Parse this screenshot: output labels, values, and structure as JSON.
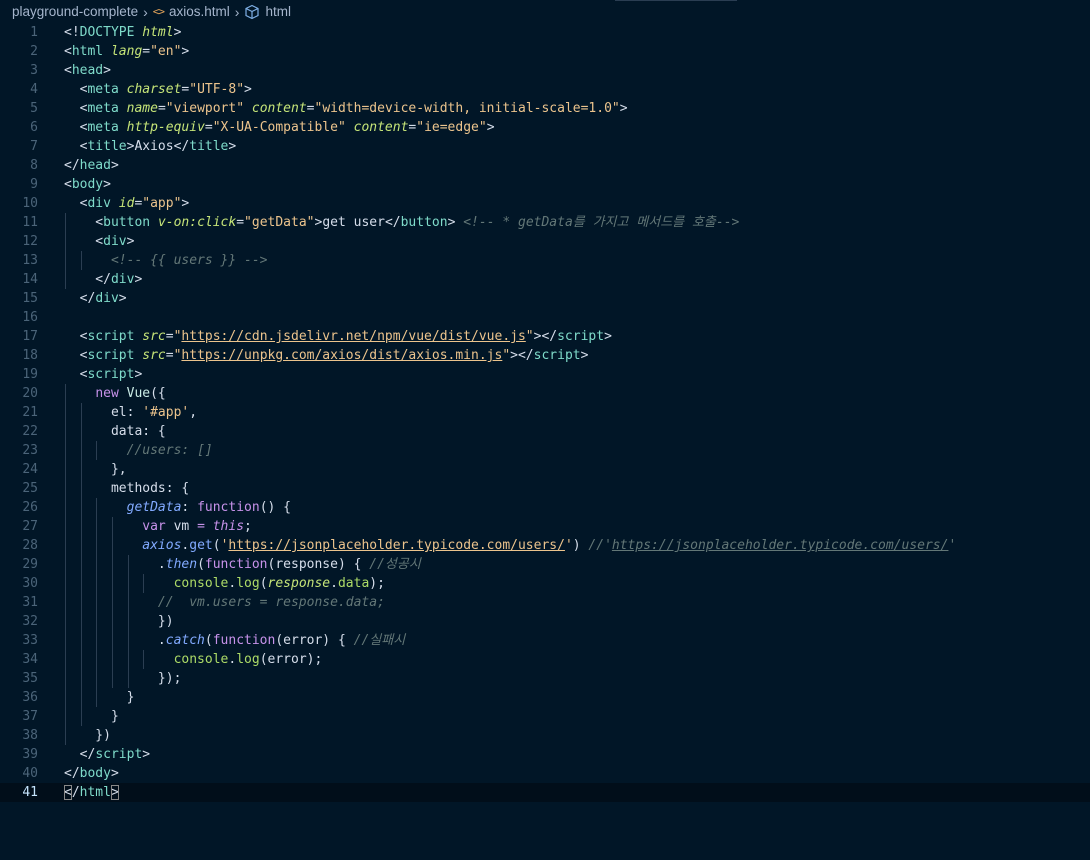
{
  "breadcrumb": {
    "folder": "playground-complete",
    "file": "axios.html",
    "file_icon": "<>",
    "symbol": "html"
  },
  "colors": {
    "background": "#011627",
    "tag": "#7fdbca",
    "attribute": "#c5e478",
    "string": "#ecc48d",
    "comment": "#637777",
    "keyword": "#c792ea",
    "function": "#82aaff"
  },
  "editor": {
    "language": "html",
    "current_line": 41,
    "lines": [
      {
        "n": "1",
        "indent": 0,
        "tokens": [
          [
            "p",
            "<!"
          ],
          [
            "t",
            "DOCTYPE"
          ],
          [
            "p",
            " "
          ],
          [
            "a",
            "html"
          ],
          [
            "p",
            ">"
          ]
        ]
      },
      {
        "n": "2",
        "indent": 0,
        "tokens": [
          [
            "p",
            "<"
          ],
          [
            "t",
            "html"
          ],
          [
            "p",
            " "
          ],
          [
            "a",
            "lang"
          ],
          [
            "p",
            "="
          ],
          [
            "s",
            "\"en\""
          ],
          [
            "p",
            ">"
          ]
        ]
      },
      {
        "n": "3",
        "indent": 0,
        "tokens": [
          [
            "p",
            "<"
          ],
          [
            "t",
            "head"
          ],
          [
            "p",
            ">"
          ]
        ]
      },
      {
        "n": "4",
        "indent": 1,
        "tokens": [
          [
            "p",
            "  <"
          ],
          [
            "t",
            "meta"
          ],
          [
            "p",
            " "
          ],
          [
            "a",
            "charset"
          ],
          [
            "p",
            "="
          ],
          [
            "s",
            "\"UTF-8\""
          ],
          [
            "p",
            ">"
          ]
        ]
      },
      {
        "n": "5",
        "indent": 1,
        "tokens": [
          [
            "p",
            "  <"
          ],
          [
            "t",
            "meta"
          ],
          [
            "p",
            " "
          ],
          [
            "a",
            "name"
          ],
          [
            "p",
            "="
          ],
          [
            "s",
            "\"viewport\""
          ],
          [
            "p",
            " "
          ],
          [
            "a",
            "content"
          ],
          [
            "p",
            "="
          ],
          [
            "s",
            "\"width=device-width, initial-scale=1.0\""
          ],
          [
            "p",
            ">"
          ]
        ]
      },
      {
        "n": "6",
        "indent": 1,
        "tokens": [
          [
            "p",
            "  <"
          ],
          [
            "t",
            "meta"
          ],
          [
            "p",
            " "
          ],
          [
            "a",
            "http-equiv"
          ],
          [
            "p",
            "="
          ],
          [
            "s",
            "\"X-UA-Compatible\""
          ],
          [
            "p",
            " "
          ],
          [
            "a",
            "content"
          ],
          [
            "p",
            "="
          ],
          [
            "s",
            "\"ie=edge\""
          ],
          [
            "p",
            ">"
          ]
        ]
      },
      {
        "n": "7",
        "indent": 1,
        "tokens": [
          [
            "p",
            "  <"
          ],
          [
            "t",
            "title"
          ],
          [
            "p",
            ">Axios</"
          ],
          [
            "t",
            "title"
          ],
          [
            "p",
            ">"
          ]
        ]
      },
      {
        "n": "8",
        "indent": 0,
        "tokens": [
          [
            "p",
            "</"
          ],
          [
            "t",
            "head"
          ],
          [
            "p",
            ">"
          ]
        ]
      },
      {
        "n": "9",
        "indent": 0,
        "tokens": [
          [
            "p",
            "<"
          ],
          [
            "t",
            "body"
          ],
          [
            "p",
            ">"
          ]
        ]
      },
      {
        "n": "10",
        "indent": 1,
        "tokens": [
          [
            "p",
            "  <"
          ],
          [
            "t",
            "div"
          ],
          [
            "p",
            " "
          ],
          [
            "a",
            "id"
          ],
          [
            "p",
            "="
          ],
          [
            "s",
            "\"app\""
          ],
          [
            "p",
            ">"
          ]
        ]
      },
      {
        "n": "11",
        "indent": 2,
        "tokens": [
          [
            "p",
            "    <"
          ],
          [
            "t",
            "button"
          ],
          [
            "p",
            " "
          ],
          [
            "a",
            "v-on:click"
          ],
          [
            "p",
            "="
          ],
          [
            "s",
            "\"getData\""
          ],
          [
            "p",
            ">get user</"
          ],
          [
            "t",
            "button"
          ],
          [
            "p",
            "> "
          ],
          [
            "c",
            "<!-- * getData를 가지고 메서드를 호출-->"
          ]
        ]
      },
      {
        "n": "12",
        "indent": 2,
        "tokens": [
          [
            "p",
            "    <"
          ],
          [
            "t",
            "div"
          ],
          [
            "p",
            ">"
          ]
        ]
      },
      {
        "n": "13",
        "indent": 3,
        "tokens": [
          [
            "p",
            "      "
          ],
          [
            "c",
            "<!-- {{ users }} -->"
          ]
        ]
      },
      {
        "n": "14",
        "indent": 2,
        "tokens": [
          [
            "p",
            "    </"
          ],
          [
            "t",
            "div"
          ],
          [
            "p",
            ">"
          ]
        ]
      },
      {
        "n": "15",
        "indent": 1,
        "tokens": [
          [
            "p",
            "  </"
          ],
          [
            "t",
            "div"
          ],
          [
            "p",
            ">"
          ]
        ]
      },
      {
        "n": "16",
        "indent": 1,
        "tokens": []
      },
      {
        "n": "17",
        "indent": 1,
        "tokens": [
          [
            "p",
            "  <"
          ],
          [
            "t",
            "script"
          ],
          [
            "p",
            " "
          ],
          [
            "a",
            "src"
          ],
          [
            "p",
            "="
          ],
          [
            "s",
            "\""
          ],
          [
            "su",
            "https://cdn.jsdelivr.net/npm/vue/dist/vue.js"
          ],
          [
            "s",
            "\""
          ],
          [
            "p",
            "></"
          ],
          [
            "t",
            "script"
          ],
          [
            "p",
            ">"
          ]
        ]
      },
      {
        "n": "18",
        "indent": 1,
        "tokens": [
          [
            "p",
            "  <"
          ],
          [
            "t",
            "script"
          ],
          [
            "p",
            " "
          ],
          [
            "a",
            "src"
          ],
          [
            "p",
            "="
          ],
          [
            "s",
            "\""
          ],
          [
            "su",
            "https://unpkg.com/axios/dist/axios.min.js"
          ],
          [
            "s",
            "\""
          ],
          [
            "p",
            "></"
          ],
          [
            "t",
            "script"
          ],
          [
            "p",
            ">"
          ]
        ]
      },
      {
        "n": "19",
        "indent": 1,
        "tokens": [
          [
            "p",
            "  <"
          ],
          [
            "t",
            "script"
          ],
          [
            "p",
            ">"
          ]
        ]
      },
      {
        "n": "20",
        "indent": 2,
        "tokens": [
          [
            "p",
            "    "
          ],
          [
            "k",
            "new"
          ],
          [
            "p",
            " "
          ],
          [
            "tn",
            "Vue"
          ],
          [
            "p",
            "({"
          ]
        ]
      },
      {
        "n": "21",
        "indent": 3,
        "tokens": [
          [
            "p",
            "      el: "
          ],
          [
            "s",
            "'#app'"
          ],
          [
            "p",
            ","
          ]
        ]
      },
      {
        "n": "22",
        "indent": 3,
        "tokens": [
          [
            "p",
            "      data: {"
          ]
        ]
      },
      {
        "n": "23",
        "indent": 4,
        "tokens": [
          [
            "p",
            "        "
          ],
          [
            "c",
            "//users: []"
          ]
        ]
      },
      {
        "n": "24",
        "indent": 3,
        "tokens": [
          [
            "p",
            "      },"
          ]
        ]
      },
      {
        "n": "25",
        "indent": 3,
        "tokens": [
          [
            "p",
            "      methods: {"
          ]
        ]
      },
      {
        "n": "26",
        "indent": 4,
        "tokens": [
          [
            "p",
            "        "
          ],
          [
            "fi",
            "getData"
          ],
          [
            "p",
            ": "
          ],
          [
            "k",
            "function"
          ],
          [
            "p",
            "() {"
          ]
        ]
      },
      {
        "n": "27",
        "indent": 5,
        "tokens": [
          [
            "p",
            "          "
          ],
          [
            "k",
            "var"
          ],
          [
            "p",
            " vm "
          ],
          [
            "k",
            "="
          ],
          [
            "p",
            " "
          ],
          [
            "ki",
            "this"
          ],
          [
            "p",
            ";"
          ]
        ]
      },
      {
        "n": "28",
        "indent": 5,
        "tokens": [
          [
            "p",
            "          "
          ],
          [
            "fi",
            "axios"
          ],
          [
            "p",
            "."
          ],
          [
            "f",
            "get"
          ],
          [
            "p",
            "("
          ],
          [
            "s",
            "'"
          ],
          [
            "su",
            "https://jsonplaceholder.typicode.com/users/"
          ],
          [
            "s",
            "'"
          ],
          [
            "p",
            ") "
          ],
          [
            "c",
            "//'"
          ],
          [
            "cu",
            "https://jsonplaceholder.typicode.com/users/"
          ],
          [
            "c",
            "'"
          ]
        ]
      },
      {
        "n": "29",
        "indent": 6,
        "tokens": [
          [
            "p",
            "            ."
          ],
          [
            "fi",
            "then"
          ],
          [
            "p",
            "("
          ],
          [
            "k",
            "function"
          ],
          [
            "p",
            "(response) { "
          ],
          [
            "c",
            "//성공시"
          ]
        ]
      },
      {
        "n": "30",
        "indent": 7,
        "tokens": [
          [
            "p",
            "              "
          ],
          [
            "cy",
            "console"
          ],
          [
            "p",
            "."
          ],
          [
            "cy",
            "log"
          ],
          [
            "p",
            "("
          ],
          [
            "a",
            "response"
          ],
          [
            "p",
            "."
          ],
          [
            "cy",
            "data"
          ],
          [
            "p",
            ");"
          ]
        ]
      },
      {
        "n": "31",
        "indent": 6,
        "tokens": [
          [
            "p",
            "            "
          ],
          [
            "c",
            "//  vm.users = response.data;"
          ]
        ]
      },
      {
        "n": "32",
        "indent": 6,
        "tokens": [
          [
            "p",
            "            })"
          ]
        ]
      },
      {
        "n": "33",
        "indent": 6,
        "tokens": [
          [
            "p",
            "            ."
          ],
          [
            "fi",
            "catch"
          ],
          [
            "p",
            "("
          ],
          [
            "k",
            "function"
          ],
          [
            "p",
            "(error) { "
          ],
          [
            "c",
            "//실패시"
          ]
        ]
      },
      {
        "n": "34",
        "indent": 7,
        "tokens": [
          [
            "p",
            "              "
          ],
          [
            "cy",
            "console"
          ],
          [
            "p",
            "."
          ],
          [
            "cy",
            "log"
          ],
          [
            "p",
            "(error);"
          ]
        ]
      },
      {
        "n": "35",
        "indent": 6,
        "tokens": [
          [
            "p",
            "            });"
          ]
        ]
      },
      {
        "n": "36",
        "indent": 4,
        "tokens": [
          [
            "p",
            "        }"
          ]
        ]
      },
      {
        "n": "37",
        "indent": 3,
        "tokens": [
          [
            "p",
            "      }"
          ]
        ]
      },
      {
        "n": "38",
        "indent": 2,
        "tokens": [
          [
            "p",
            "    })"
          ]
        ]
      },
      {
        "n": "39",
        "indent": 1,
        "tokens": [
          [
            "p",
            "  </"
          ],
          [
            "t",
            "script"
          ],
          [
            "p",
            ">"
          ]
        ]
      },
      {
        "n": "40",
        "indent": 0,
        "tokens": [
          [
            "p",
            "</"
          ],
          [
            "t",
            "body"
          ],
          [
            "p",
            ">"
          ]
        ]
      },
      {
        "n": "41",
        "indent": 0,
        "tokens": [
          [
            "pb",
            "<"
          ],
          [
            "p",
            "/"
          ],
          [
            "t",
            "html"
          ],
          [
            "pb",
            ">"
          ]
        ]
      }
    ]
  }
}
